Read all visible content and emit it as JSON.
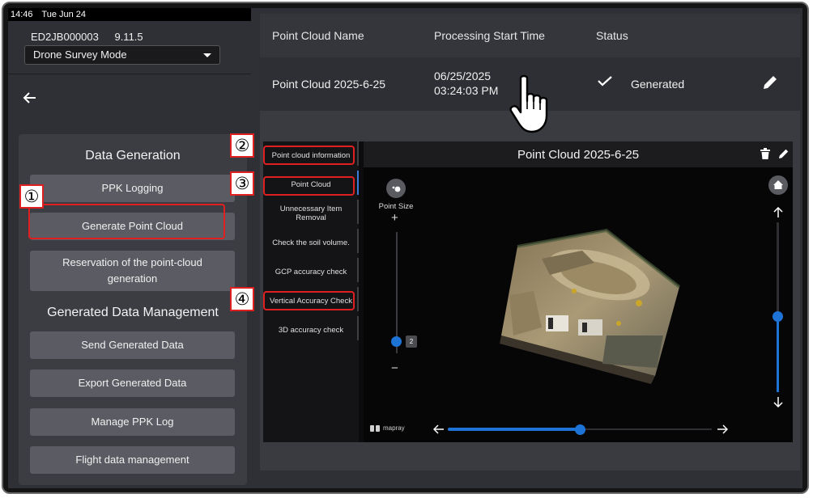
{
  "status_bar": {
    "time": "14:46",
    "date": "Tue Jun 24"
  },
  "device": {
    "id": "ED2JB000003",
    "version": "9.11.5"
  },
  "mode_select": {
    "value": "Drone Survey Mode"
  },
  "data_generation": {
    "title": "Data Generation",
    "ppk_logging": "PPK Logging",
    "generate_point_cloud": "Generate Point Cloud",
    "reservation": "Reservation of the point-cloud generation"
  },
  "data_management": {
    "title": "Generated Data Management",
    "send": "Send Generated Data",
    "export": "Export Generated Data",
    "manage_ppk": "Manage PPK Log",
    "flight_data": "Flight data management"
  },
  "badges": [
    "①",
    "②",
    "③",
    "④"
  ],
  "table": {
    "headers": {
      "name": "Point Cloud Name",
      "start": "Processing Start Time",
      "status": "Status"
    },
    "rows": [
      {
        "name": "Point Cloud 2025-6-25",
        "date": "06/25/2025",
        "time": "03:24:03 PM",
        "status": "Generated"
      }
    ]
  },
  "viewer": {
    "title": "Point Cloud 2025-6-25",
    "tabs": {
      "info": "Point cloud information",
      "point_cloud": "Point Cloud",
      "removal": "Unnecessary Item Removal",
      "soil": "Check the soil volume.",
      "gcp": "GCP accuracy check",
      "vertical": "Vertical Accuracy Check",
      "accuracy3d": "3D accuracy check"
    },
    "point_size_label": "Point Size",
    "point_size_plus": "+",
    "point_size_minus": "−",
    "point_size_value": "2",
    "logo_text": "mapray",
    "point_size_level": 0.1,
    "vertical_slider_level": 0.45,
    "horizontal_slider_level": 0.5
  },
  "colors": {
    "accent": "#1e74d6",
    "highlight": "#e02020"
  },
  "icons": [
    "back-arrow-icon",
    "chevron-down-icon",
    "check-icon",
    "pencil-icon",
    "hand-pointer-icon",
    "trash-icon",
    "home-icon",
    "point-size-icon",
    "arrow-up-icon",
    "arrow-down-icon",
    "arrow-left-icon",
    "arrow-right-icon",
    "mapray-logo-icon"
  ]
}
